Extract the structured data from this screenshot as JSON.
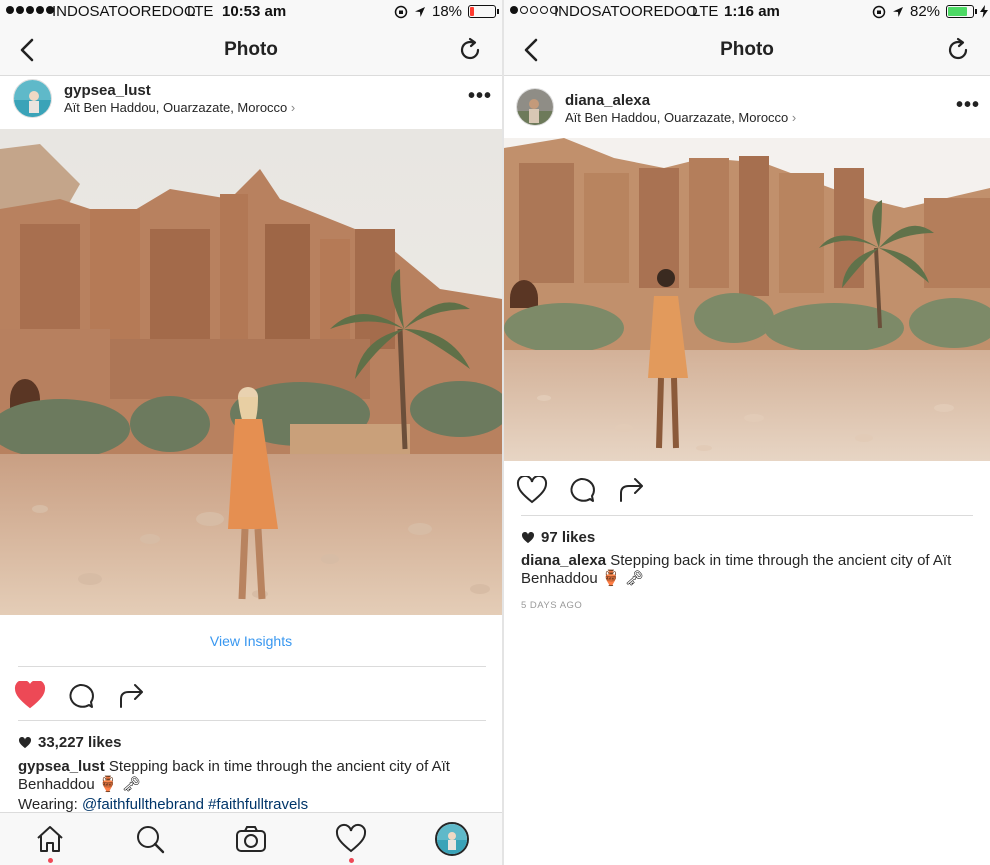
{
  "left": {
    "status": {
      "carrier": "INDOSATOOREDOO",
      "network": "LTE",
      "time": "10:53 am",
      "battery": "18%",
      "battery_level": 0.18,
      "battery_color": "#ff3b30"
    },
    "nav": {
      "title": "Photo"
    },
    "post": {
      "username": "gypsea_lust",
      "location": "Aït Ben Haddou, Ouarzazate, Morocco",
      "more": "•••",
      "insights": "View Insights",
      "likes": "33,227 likes",
      "liked": true,
      "caption_user": "gypsea_lust",
      "caption_text": "Stepping back in time through the ancient city of Aït Benhaddou 🏺 🗝",
      "wearing_label": "Wearing:",
      "wearing_link1": "@faithfullthebrand",
      "wearing_link2": "#faithfulltravels"
    },
    "tabs": [
      "home-icon",
      "search-icon",
      "camera-icon",
      "activity-heart-icon",
      "profile-avatar"
    ]
  },
  "right": {
    "status": {
      "carrier": "INDOSATOOREDOO",
      "network": "LTE",
      "time": "1:16 am",
      "battery": "82%",
      "battery_level": 0.82,
      "battery_color": "#4cd964"
    },
    "nav": {
      "title": "Photo"
    },
    "post": {
      "username": "diana_alexa",
      "location": "Aït Ben Haddou, Ouarzazate, Morocco",
      "more": "•••",
      "likes": "97 likes",
      "liked": false,
      "caption_user": "diana_alexa",
      "caption_text": "Stepping back in time through the ancient city of Aït Benhaddou 🏺 🗝",
      "time_ago": "5 DAYS AGO"
    }
  },
  "colors": {
    "like_red": "#ed4956",
    "link_blue": "#3897f0",
    "navy_link": "#003569",
    "sand": "#c9a07a",
    "sky": "#ece8e2"
  }
}
